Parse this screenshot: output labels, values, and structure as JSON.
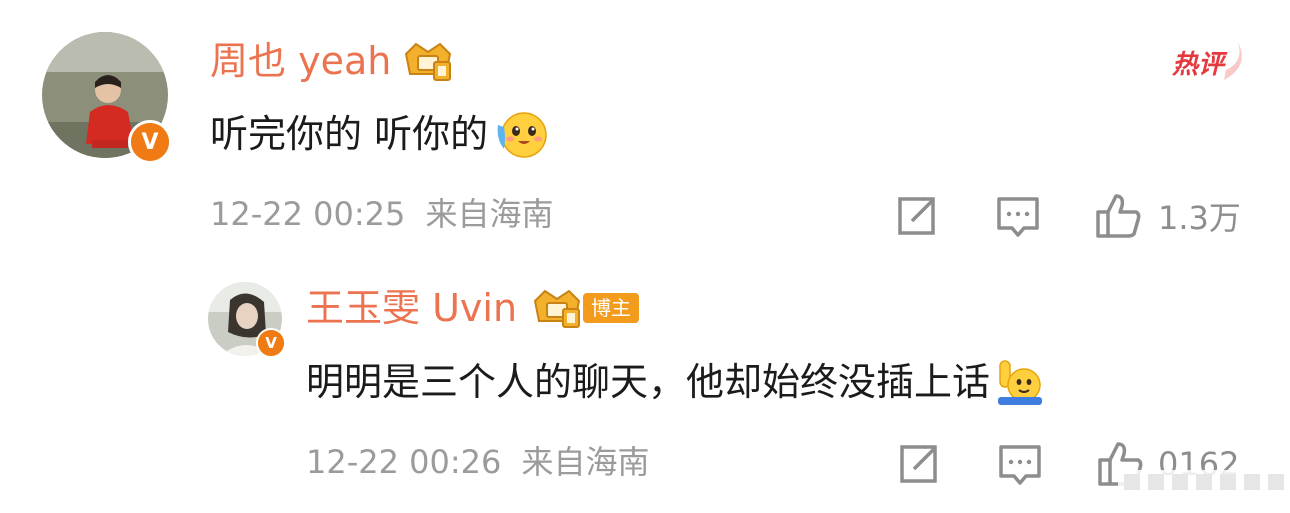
{
  "colors": {
    "name": "#eb7350",
    "meta": "#9b9b9b",
    "content": "#1b1b1b",
    "hot": "#e6393f",
    "author_tag_bg": "#f39b1c",
    "verified_badge": "#f5a623"
  },
  "comment": {
    "username": "周也 yeah",
    "badge_icon": "crown-medal-icon",
    "hot_label": "热评",
    "text": "听完你的 听你的",
    "emoji": "cute-crying-emoji",
    "time": "12-22 00:25",
    "location": "来自海南",
    "like_count": "1.3万"
  },
  "reply": {
    "username": "王玉雯 Uvin",
    "badge_icon": "crown-medal-icon",
    "author_tag": "博主",
    "text": "明明是三个人的聊天，他却始终没插上话",
    "emoji": "raising-hand-emoji",
    "time": "12-22 00:26",
    "location": "来自海南",
    "like_count": "0162"
  }
}
